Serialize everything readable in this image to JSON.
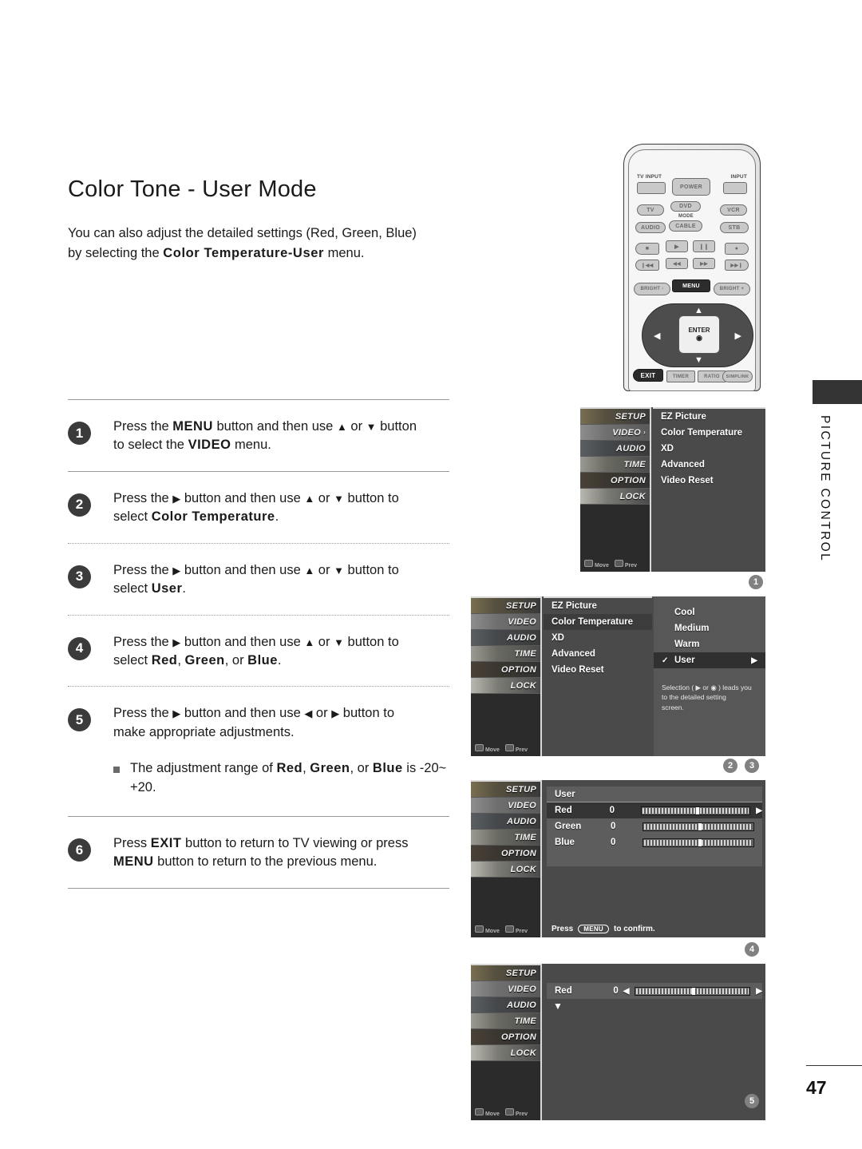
{
  "document": {
    "title": "Color Tone - User Mode",
    "intro_line1": "You can also adjust the detailed settings (Red, Green, Blue)",
    "intro_line2_pre": "by selecting the ",
    "intro_line2_bold": "Color Temperature-User",
    "intro_line2_post": " menu.",
    "section_label": "PICTURE CONTROL",
    "page_number": "47"
  },
  "steps": [
    {
      "number": "1",
      "line1_a": "Press the ",
      "line1_b": "MENU",
      "line1_c": " button and then use ",
      "line1_d": "▲",
      "line1_e": " or ",
      "line1_f": "▼",
      "line1_g": " button",
      "line2_a": "to select the ",
      "line2_b": "VIDEO",
      "line2_c": " menu."
    },
    {
      "number": "2",
      "line1_a": "Press the ",
      "line1_b": "▶",
      "line1_c": " button and then use ",
      "line1_d": "▲",
      "line1_e": " or ",
      "line1_f": "▼",
      "line1_g": " button to",
      "line2_a": "select ",
      "line2_b": "Color Temperature",
      "line2_c": "."
    },
    {
      "number": "3",
      "line1_a": "Press the ",
      "line1_b": "▶",
      "line1_c": " button and then use ",
      "line1_d": "▲",
      "line1_e": " or ",
      "line1_f": "▼",
      "line1_g": " button to",
      "line2_a": "select ",
      "line2_b": "User",
      "line2_c": "."
    },
    {
      "number": "4",
      "line1_a": "Press the ",
      "line1_b": "▶",
      "line1_c": " button and then use ",
      "line1_d": "▲",
      "line1_e": " or ",
      "line1_f": "▼",
      "line1_g": " button to",
      "line2_a": "select ",
      "line2_b": "Red",
      "line2_c": ", ",
      "line2_d": "Green",
      "line2_e": ", or ",
      "line2_f": "Blue",
      "line2_g": "."
    },
    {
      "number": "5",
      "line1_a": "Press the ",
      "line1_b": "▶",
      "line1_c": " button and then use ",
      "line1_d": "◀",
      "line1_e": " or ",
      "line1_f": "▶",
      "line1_g": " button to",
      "line2_a": "make appropriate adjustments.",
      "note_a": "The adjustment range of ",
      "note_b": "Red",
      "note_c": ", ",
      "note_d": "Green",
      "note_e": ", or ",
      "note_f": "Blue",
      "note_g": " is -20~ +20."
    },
    {
      "number": "6",
      "line1_a": "Press ",
      "line1_b": "EXIT",
      "line1_c": " button to return to TV viewing or press",
      "line2_a": "",
      "line2_b": "MENU",
      "line2_c": " button to return to the previous menu."
    }
  ],
  "remote": {
    "tv_input_label": "TV INPUT",
    "input_label": "INPUT",
    "power_label": "POWER",
    "mode_label": "MODE",
    "keys_row1": [
      "TV",
      "DVD",
      "VCR"
    ],
    "keys_row2": [
      "AUDIO",
      "CABLE",
      "STB"
    ],
    "transport_row1": [
      "■",
      "▶",
      "❙❙",
      "●"
    ],
    "transport_row2": [
      "❙◀◀",
      "◀◀",
      "▶▶",
      "▶▶❙"
    ],
    "bright_minus": "BRIGHT -",
    "bright_plus": "BRIGHT +",
    "menu_label": "MENU",
    "enter_label": "ENTER",
    "enter_symbol": "◉",
    "up": "▲",
    "down": "▼",
    "left": "◀",
    "right": "▶",
    "exit_label": "EXIT",
    "bottom_keys": [
      "TIMER",
      "RATIO",
      "SIMPLINK"
    ]
  },
  "osd_common": {
    "sidebar_items": [
      "SETUP",
      "VIDEO",
      "AUDIO",
      "TIME",
      "OPTION",
      "LOCK"
    ],
    "footer_move": "Move",
    "footer_prev": "Prev"
  },
  "osd1": {
    "marker": "1",
    "selected_sidebar": "VIDEO",
    "menu_items": [
      "EZ Picture",
      "Color Temperature",
      "XD",
      "Advanced",
      "Video Reset"
    ]
  },
  "osd2": {
    "markers": [
      "2",
      "3"
    ],
    "menu_items": [
      "EZ Picture",
      "Color Temperature",
      "XD",
      "Advanced",
      "Video Reset"
    ],
    "selected_menu_item": "Color Temperature",
    "submenu_items": [
      "Cool",
      "Medium",
      "Warm",
      "User"
    ],
    "selected_submenu_item": "User",
    "check_mark": "✓",
    "right_arrow": "▶",
    "hint_line1": "Selection ( ▶ or ◉ ) leads you",
    "hint_line2": "to the detailed setting",
    "hint_line3": "screen."
  },
  "osd3": {
    "marker": "4",
    "panel_title": "User",
    "sliders": [
      {
        "name": "Red",
        "value": "0",
        "percent": 50,
        "arrow": "▶"
      },
      {
        "name": "Green",
        "value": "0",
        "percent": 50,
        "arrow": ""
      },
      {
        "name": "Blue",
        "value": "0",
        "percent": 50,
        "arrow": ""
      }
    ],
    "confirm_pre": "Press",
    "confirm_key": "MENU",
    "confirm_post": "to confirm."
  },
  "osd4": {
    "marker": "5",
    "slider": {
      "name": "Red",
      "value": "0",
      "percent": 50,
      "left_arrow": "◀",
      "right_arrow": "▶"
    },
    "down_caret": "▼"
  }
}
